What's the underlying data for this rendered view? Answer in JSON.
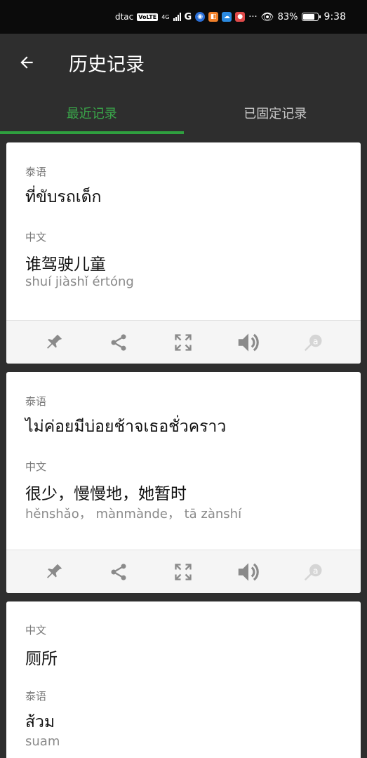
{
  "status_bar": {
    "carrier": "dtac",
    "volte": "VoLTE",
    "network": "4G",
    "g_icon": "G",
    "battery": "83%",
    "time": "9:38",
    "more": "···"
  },
  "app_bar": {
    "title": "历史记录"
  },
  "tabs": [
    {
      "label": "最近记录",
      "active": true
    },
    {
      "label": "已固定记录",
      "active": false
    }
  ],
  "cards": [
    {
      "source_lang": "泰语",
      "source_text": "ที่ขับรถเด็ก",
      "target_lang": "中文",
      "target_text": "谁驾驶儿童",
      "pinyin": "shuí jiàshǐ értóng"
    },
    {
      "source_lang": "泰语",
      "source_text": "ไม่ค่อยมีบ่อยช้าจเธอชั่วคราว",
      "target_lang": "中文",
      "target_text": "很少，慢慢地，她暂时",
      "pinyin": "hěnshǎo， mànmànde， tā zànshí"
    },
    {
      "source_lang": "中文",
      "source_text": "厕所",
      "target_lang": "泰语",
      "target_text": "ส้วม",
      "pinyin": "suam"
    }
  ],
  "icons": {
    "back": "arrow-left-icon",
    "pin": "pin-icon",
    "share": "share-icon",
    "fullscreen": "fullscreen-icon",
    "speaker": "speaker-icon",
    "transliterate": "transliteration-icon"
  },
  "colors": {
    "accent": "#2fa03f",
    "background": "#2e2e2e",
    "status_bar": "#0b0b0b",
    "card": "#ffffff",
    "action_bar": "#f5f5f5"
  }
}
